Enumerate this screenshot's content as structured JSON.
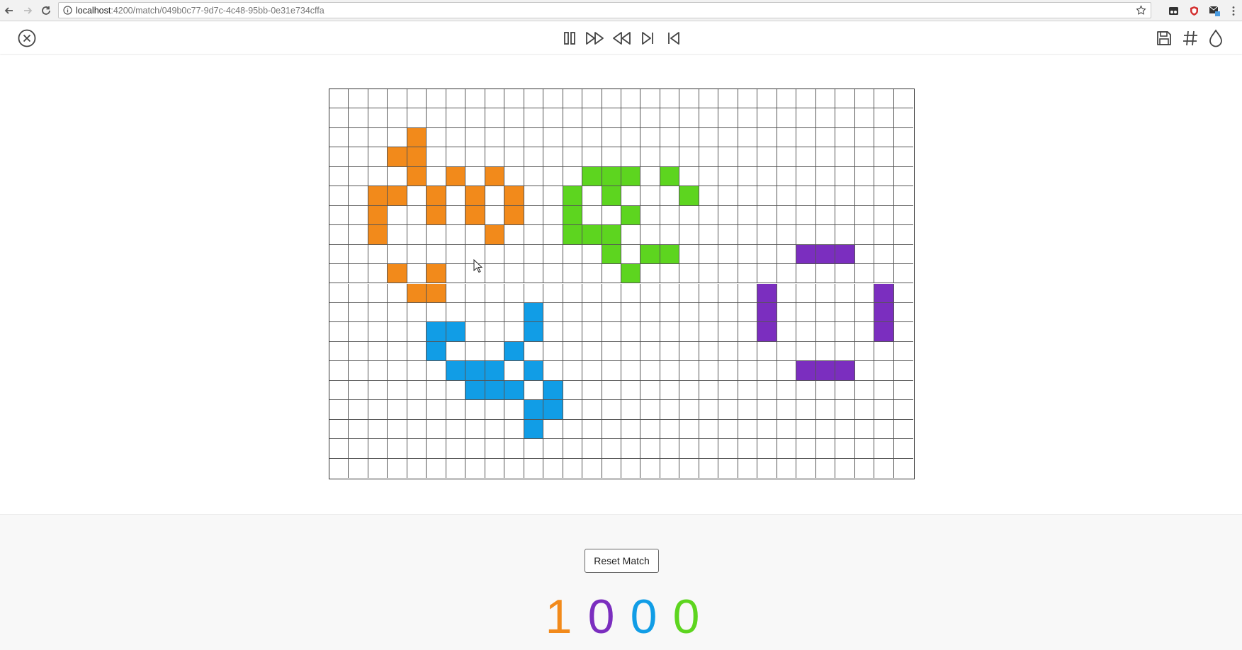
{
  "browser": {
    "url_host": "localhost",
    "url_rest": ":4200/match/049b0c77-9d7c-4c48-95bb-0e31e734cffa"
  },
  "toolbar": {
    "left": [
      "close-icon"
    ],
    "playback": [
      "pause-icon",
      "fast-forward-icon",
      "rewind-icon",
      "step-forward-icon",
      "step-back-icon"
    ],
    "right": [
      "save-icon",
      "grid-hash-icon",
      "drop-icon"
    ]
  },
  "board": {
    "cols": 30,
    "rows": 20,
    "grid_color": "#555555",
    "players": [
      {
        "name": "orange",
        "color": "#f28a1b",
        "cells": [
          [
            4,
            2
          ],
          [
            3,
            3
          ],
          [
            4,
            3
          ],
          [
            4,
            4
          ],
          [
            6,
            4
          ],
          [
            8,
            4
          ],
          [
            2,
            5
          ],
          [
            3,
            5
          ],
          [
            5,
            5
          ],
          [
            7,
            5
          ],
          [
            9,
            5
          ],
          [
            2,
            6
          ],
          [
            5,
            6
          ],
          [
            7,
            6
          ],
          [
            9,
            6
          ],
          [
            2,
            7
          ],
          [
            8,
            7
          ],
          [
            3,
            9
          ],
          [
            5,
            9
          ],
          [
            4,
            10
          ],
          [
            5,
            10
          ]
        ]
      },
      {
        "name": "green",
        "color": "#5dd51f",
        "cells": [
          [
            13,
            4
          ],
          [
            14,
            4
          ],
          [
            15,
            4
          ],
          [
            17,
            4
          ],
          [
            12,
            5
          ],
          [
            14,
            5
          ],
          [
            18,
            5
          ],
          [
            12,
            6
          ],
          [
            15,
            6
          ],
          [
            12,
            7
          ],
          [
            13,
            7
          ],
          [
            14,
            7
          ],
          [
            14,
            8
          ],
          [
            16,
            8
          ],
          [
            17,
            8
          ],
          [
            15,
            9
          ]
        ]
      },
      {
        "name": "blue",
        "color": "#119de6",
        "cells": [
          [
            10,
            11
          ],
          [
            5,
            12
          ],
          [
            6,
            12
          ],
          [
            10,
            12
          ],
          [
            5,
            13
          ],
          [
            9,
            13
          ],
          [
            6,
            14
          ],
          [
            7,
            14
          ],
          [
            8,
            14
          ],
          [
            10,
            14
          ],
          [
            7,
            15
          ],
          [
            8,
            15
          ],
          [
            9,
            15
          ],
          [
            11,
            15
          ],
          [
            10,
            16
          ],
          [
            11,
            16
          ],
          [
            10,
            17
          ]
        ]
      },
      {
        "name": "purple",
        "color": "#7b2ebf",
        "cells": [
          [
            24,
            8
          ],
          [
            25,
            8
          ],
          [
            26,
            8
          ],
          [
            22,
            10
          ],
          [
            28,
            10
          ],
          [
            22,
            11
          ],
          [
            28,
            11
          ],
          [
            22,
            12
          ],
          [
            28,
            12
          ],
          [
            24,
            14
          ],
          [
            25,
            14
          ],
          [
            26,
            14
          ]
        ]
      }
    ]
  },
  "controls": {
    "reset_label": "Reset Match"
  },
  "scores": [
    {
      "value": "1",
      "color": "#f28a1b"
    },
    {
      "value": "0",
      "color": "#7b2ebf"
    },
    {
      "value": "0",
      "color": "#119de6"
    },
    {
      "value": "0",
      "color": "#5dd51f"
    }
  ]
}
